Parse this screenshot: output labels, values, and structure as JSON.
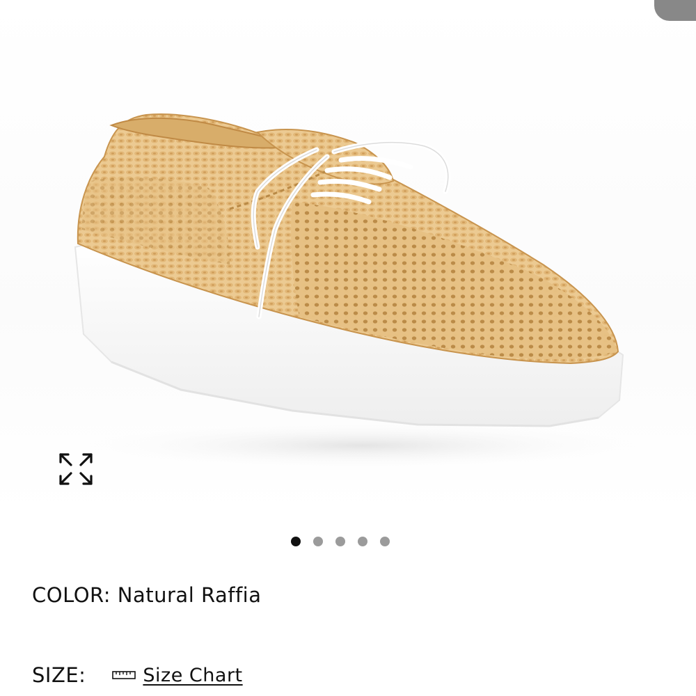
{
  "product": {
    "image_icon": "raffia-wedge-oxford-photo",
    "expand_icon": "expand-arrows-icon"
  },
  "carousel": {
    "total": 5,
    "active_index": 1
  },
  "color": {
    "label": "COLOR:",
    "value": "Natural Raffia"
  },
  "size": {
    "label": "SIZE:",
    "size_chart_label": "Size Chart",
    "size_chart_icon": "ruler-icon"
  },
  "colors": {
    "raffia": "#e8c58e",
    "raffia_dark": "#c99a55",
    "sole": "#ffffff",
    "dot_active": "#111111",
    "dot_inactive": "#9b9b9b"
  }
}
